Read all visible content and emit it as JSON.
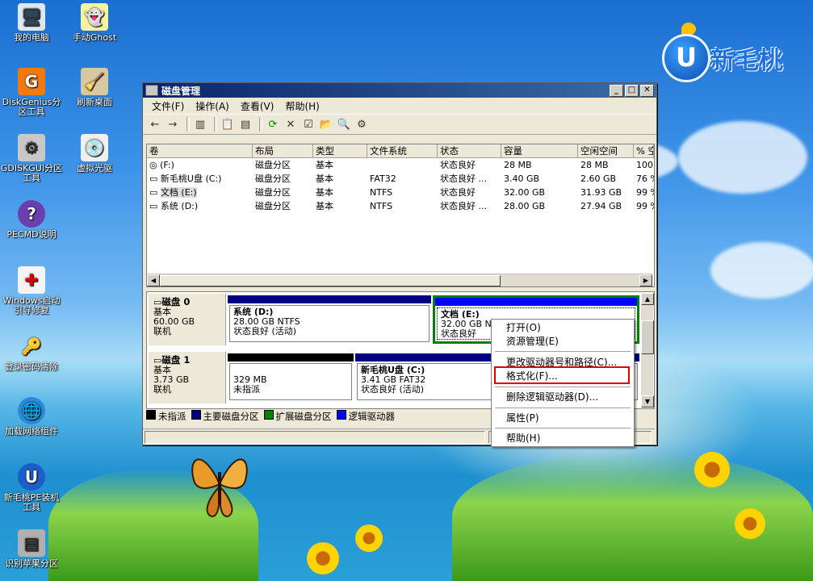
{
  "desktop": {
    "icons": [
      {
        "label": "我的电脑",
        "icon": "computer-icon"
      },
      {
        "label": "手动Ghost",
        "icon": "ghost-icon"
      },
      {
        "label": "DiskGenius分区工具",
        "icon": "diskgenius-icon"
      },
      {
        "label": "刷新桌面",
        "icon": "broom-icon"
      },
      {
        "label": "GDISKGUI分区工具",
        "icon": "gdisk-icon"
      },
      {
        "label": "虚拟光驱",
        "icon": "cd-icon"
      },
      {
        "label": "PECMD说明",
        "icon": "help-icon"
      },
      {
        "label": "Windows启动引导修复",
        "icon": "firstaid-icon"
      },
      {
        "label": "登录密码清除",
        "icon": "key-icon"
      },
      {
        "label": "加载网络组件",
        "icon": "globe-icon"
      },
      {
        "label": "新毛桃PE装机工具",
        "icon": "pe-icon"
      },
      {
        "label": "识别苹果分区",
        "icon": "hdd-icon"
      }
    ],
    "logo_text": "新毛桃",
    "logo_letter": "U"
  },
  "window": {
    "title": "磁盘管理",
    "menu": [
      "文件(F)",
      "操作(A)",
      "查看(V)",
      "帮助(H)"
    ],
    "columns": [
      "卷",
      "布局",
      "类型",
      "文件系统",
      "状态",
      "容量",
      "空闲空间",
      "% 空"
    ],
    "volumes": [
      {
        "name": "(F:)",
        "layout": "磁盘分区",
        "type": "基本",
        "fs": "",
        "status": "状态良好",
        "capacity": "28 MB",
        "free": "28 MB",
        "pct": "100 %"
      },
      {
        "name": "新毛桃U盘 (C:)",
        "layout": "磁盘分区",
        "type": "基本",
        "fs": "FAT32",
        "status": "状态良好 ...",
        "capacity": "3.40 GB",
        "free": "2.60 GB",
        "pct": "76 %"
      },
      {
        "name": "文档 (E:)",
        "layout": "磁盘分区",
        "type": "基本",
        "fs": "NTFS",
        "status": "状态良好",
        "capacity": "32.00 GB",
        "free": "31.93 GB",
        "pct": "99 %"
      },
      {
        "name": "系统 (D:)",
        "layout": "磁盘分区",
        "type": "基本",
        "fs": "NTFS",
        "status": "状态良好 ...",
        "capacity": "28.00 GB",
        "free": "27.94 GB",
        "pct": "99 %"
      }
    ],
    "disks": [
      {
        "name": "磁盘 0",
        "type": "基本",
        "size": "60.00 GB",
        "state": "联机",
        "partitions": [
          {
            "title": "系统 (D:)",
            "line1": "28.00 GB NTFS",
            "line2": "状态良好 (活动)"
          },
          {
            "title": "文档 (E:)",
            "line1": "32.00 GB NTFS",
            "line2": "状态良好"
          }
        ]
      },
      {
        "name": "磁盘 1",
        "type": "基本",
        "size": "3.73 GB",
        "state": "联机",
        "partitions": [
          {
            "title": "",
            "line1": "329 MB",
            "line2": "未指派"
          },
          {
            "title": "新毛桃U盘 (C:)",
            "line1": "3.41 GB FAT32",
            "line2": "状态良好 (活动)"
          }
        ]
      }
    ],
    "legend": [
      "未指派",
      "主要磁盘分区",
      "扩展磁盘分区",
      "逻辑驱动器"
    ],
    "legend_colors": [
      "#000000",
      "#000080",
      "#008000",
      "#0000ff"
    ]
  },
  "context_menu": {
    "items": [
      "打开(O)",
      "资源管理(E)",
      "更改驱动器号和路径(C)...",
      "格式化(F)...",
      "删除逻辑驱动器(D)...",
      "属性(P)",
      "帮助(H)"
    ],
    "highlighted": "格式化(F)..."
  }
}
